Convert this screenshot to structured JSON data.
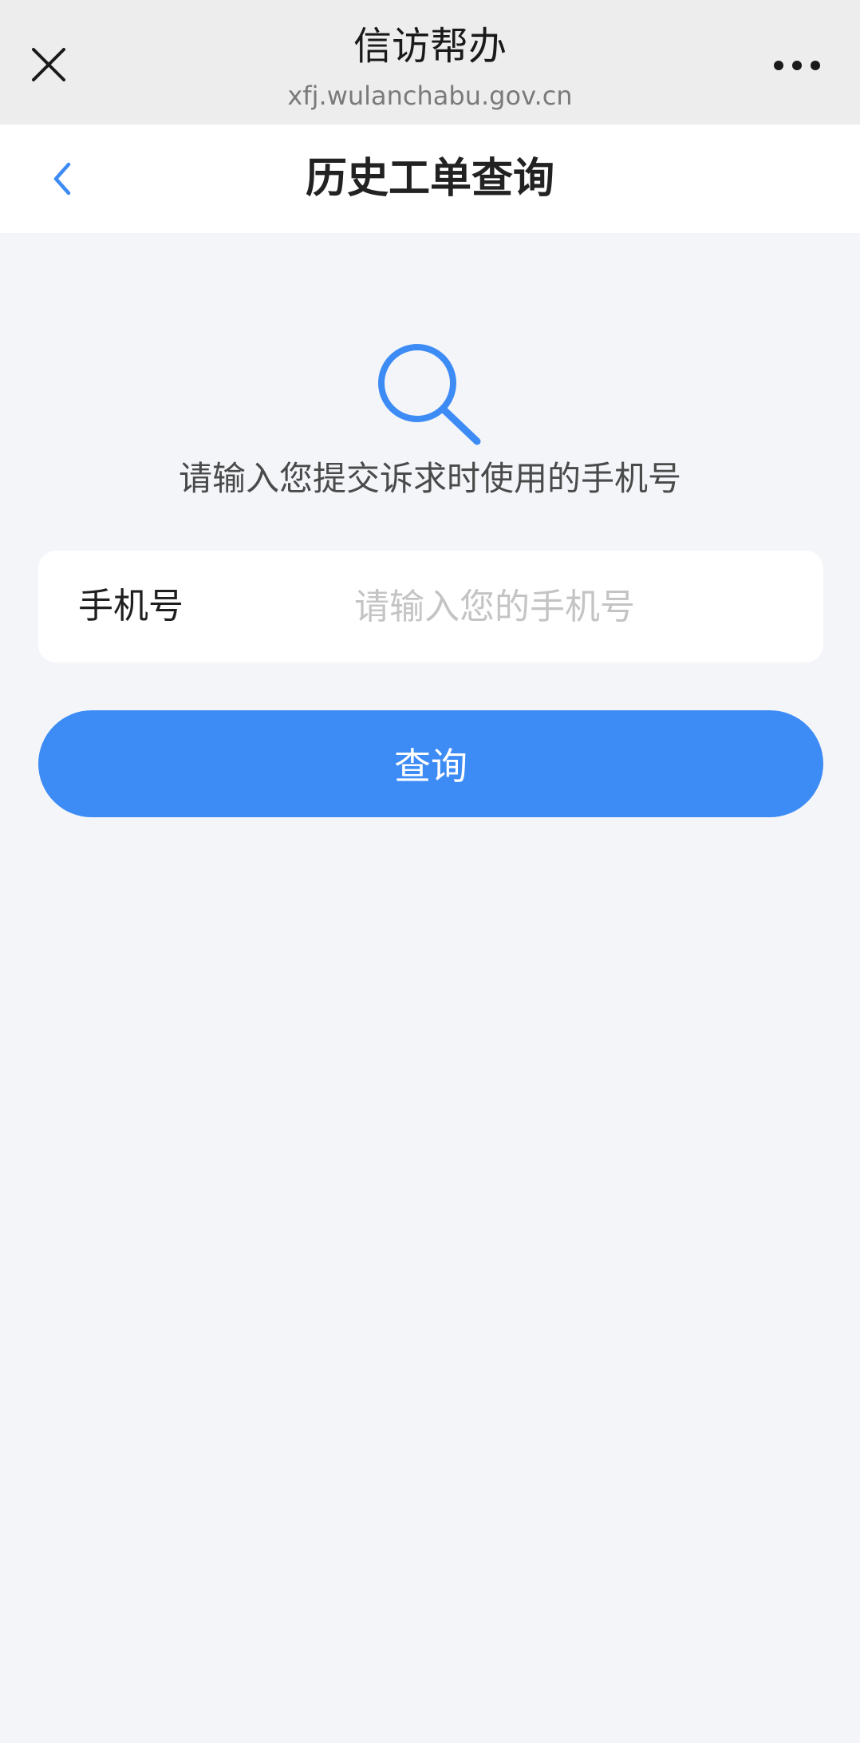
{
  "browser": {
    "title": "信访帮办",
    "url": "xfj.wulanchabu.gov.cn",
    "close_icon": "close-icon",
    "more_icon": "more-horizontal-icon"
  },
  "header": {
    "title": "历史工单查询",
    "back_icon": "chevron-left-icon"
  },
  "main": {
    "search_icon": "search-icon",
    "hint": "请输入您提交诉求时使用的手机号",
    "phone_field": {
      "label": "手机号",
      "value": "",
      "placeholder": "请输入您的手机号"
    },
    "query_button": "查询"
  },
  "colors": {
    "accent": "#3d8bf5",
    "background": "#f3f5f9",
    "browser_bar": "#ededed",
    "placeholder": "#c4c4c4"
  }
}
